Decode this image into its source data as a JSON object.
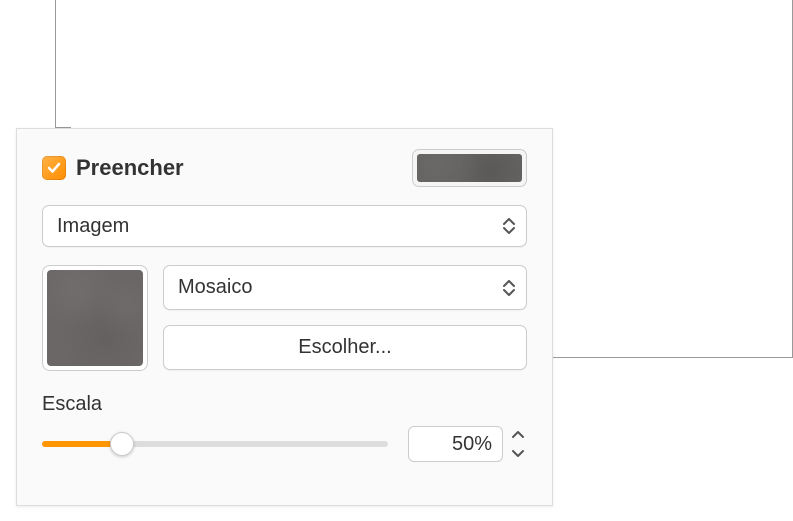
{
  "fill": {
    "checked": true,
    "label": "Preencher",
    "type": "Imagem",
    "mode": "Mosaico",
    "choose_label": "Escolher...",
    "swatch_color": "#636060"
  },
  "scale": {
    "label": "Escala",
    "value": "50%",
    "percent": 23
  }
}
